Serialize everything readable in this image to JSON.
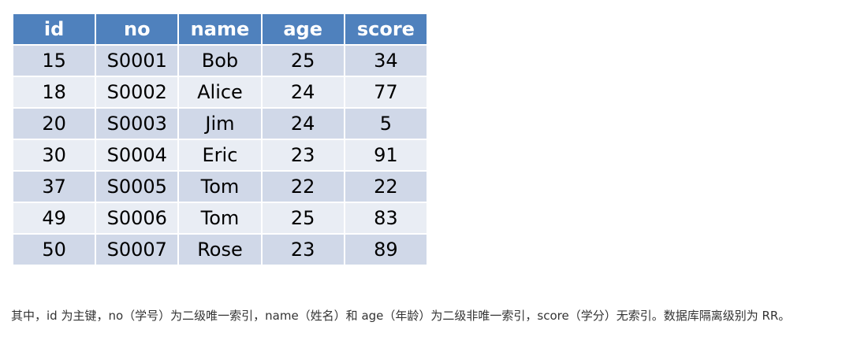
{
  "table": {
    "headers": [
      "id",
      "no",
      "name",
      "age",
      "score"
    ],
    "rows": [
      [
        "15",
        "S0001",
        "Bob",
        "25",
        "34"
      ],
      [
        "18",
        "S0002",
        "Alice",
        "24",
        "77"
      ],
      [
        "20",
        "S0003",
        "Jim",
        "24",
        "5"
      ],
      [
        "30",
        "S0004",
        "Eric",
        "23",
        "91"
      ],
      [
        "37",
        "S0005",
        "Tom",
        "22",
        "22"
      ],
      [
        "49",
        "S0006",
        "Tom",
        "25",
        "83"
      ],
      [
        "50",
        "S0007",
        "Rose",
        "23",
        "89"
      ]
    ],
    "colors": {
      "header_bg": "#4f81bd",
      "row_odd_bg": "#d0d8e8",
      "row_even_bg": "#e9edf4"
    }
  },
  "description": "其中，id 为主键，no（学号）为二级唯一索引，name（姓名）和 age（年龄）为二级非唯一索引，score（学分）无索引。数据库隔离级别为 RR。"
}
